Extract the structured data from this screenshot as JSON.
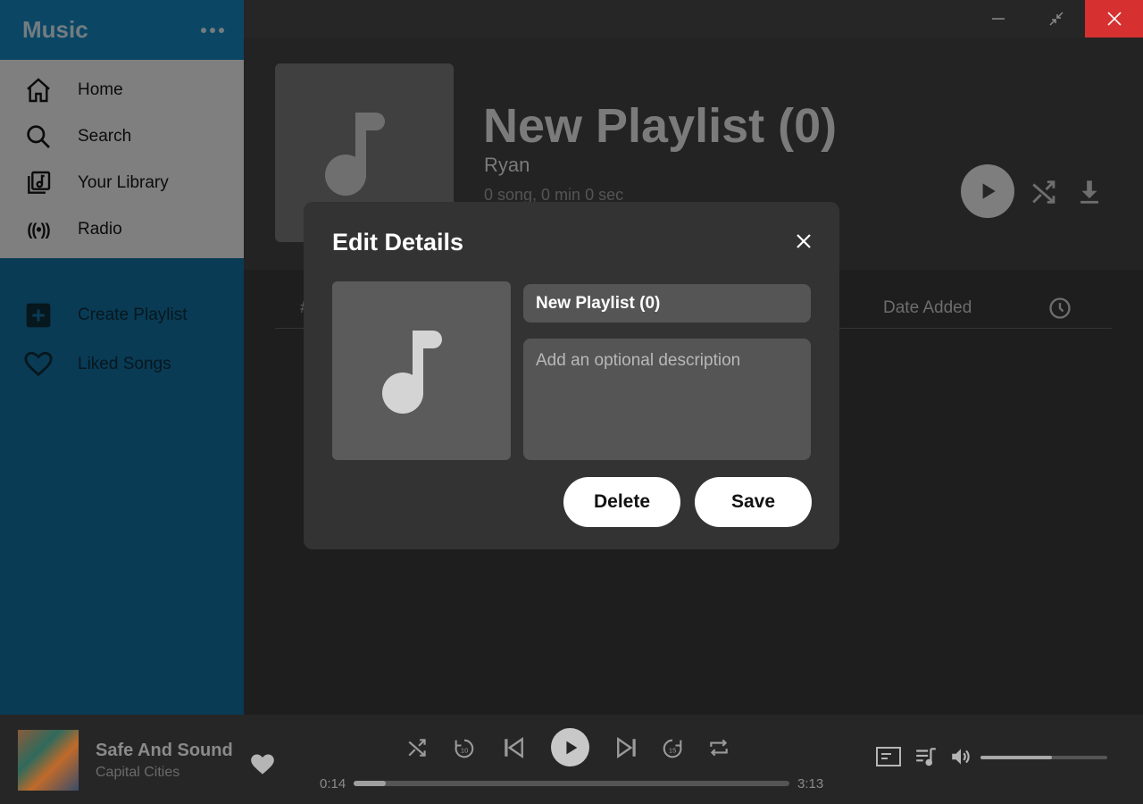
{
  "sidebar": {
    "brand": "Music",
    "nav": [
      {
        "label": "Home",
        "icon": "home-icon"
      },
      {
        "label": "Search",
        "icon": "search-icon"
      },
      {
        "label": "Your Library",
        "icon": "library-icon"
      },
      {
        "label": "Radio",
        "icon": "radio-icon"
      }
    ],
    "playlists": [
      {
        "label": "Create Playlist",
        "icon": "plus-square-icon"
      },
      {
        "label": "Liked Songs",
        "icon": "heart-icon"
      }
    ]
  },
  "playlist": {
    "title": "New Playlist (0)",
    "owner": "Ryan",
    "meta": "0 song, 0 min 0 sec",
    "table_headers": {
      "hash": "#",
      "date_added": "Date Added"
    }
  },
  "modal": {
    "title": "Edit Details",
    "name_value": "New Playlist (0)",
    "description_placeholder": "Add an optional description",
    "delete_label": "Delete",
    "save_label": "Save"
  },
  "player": {
    "track_title": "Safe And Sound",
    "artist": "Capital Cities",
    "time_current": "0:14",
    "time_total": "3:13",
    "progress_fraction": 0.074,
    "volume_fraction": 0.56
  },
  "colors": {
    "sidebar_blue": "#126c9b",
    "close_red": "#d63030",
    "modal_bg": "#333333"
  }
}
